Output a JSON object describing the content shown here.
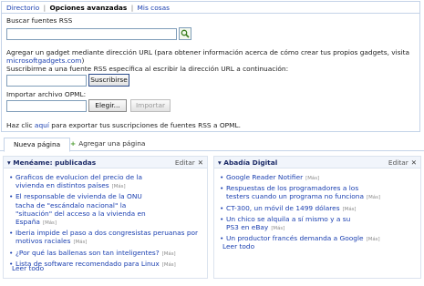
{
  "topnav": {
    "directorio": "Directorio",
    "separator": "|",
    "opciones": "Opciones avanzadas",
    "misCosas": "Mis cosas"
  },
  "panel": {
    "buscar_label": "Buscar fuentes RSS",
    "buscar_value": "",
    "url_text": "Agregar un gadget mediante dirección URL (para obtener información acerca de cómo crear tus propios gadgets, visita",
    "url_link": "microsoftgadgets.com",
    "url_after": ")",
    "subscribe_text": "Suscribirme a una fuente RSS específica al escribir la dirección URL a continuación:",
    "subscribe_value": "",
    "subscribe_button": "Suscribirse",
    "import_label": "Importar archivo OPML:",
    "import_value": "",
    "browse_button": "Elegir...",
    "import_button": "Importar",
    "export_pre": "Haz clic",
    "export_link": "aquí",
    "export_post": "para exportar tus suscripciones de fuentes RSS a OPML."
  },
  "tabs": {
    "active": "Nueva página",
    "add": "Agregar una página"
  },
  "gadgets": [
    {
      "title": "Menéame: publicadas",
      "edit": "Editar",
      "items": [
        {
          "lines": [
            "Graficos de evolucion del precio de la",
            "vivienda en distintos países"
          ],
          "more": "[Más]"
        },
        {
          "lines": [
            "El responsable de vivienda de la ONU",
            "tacha de \"escándalo nacional\" la",
            "\"situación\" del acceso a la vivienda en",
            "España"
          ],
          "more": "[Más]"
        },
        {
          "lines": [
            "Iberia impide el paso a dos congresistas peruanas por",
            "motivos raciales"
          ],
          "more": "[Más]"
        },
        {
          "lines": [
            "¿Por qué las ballenas son tan inteligentes?"
          ],
          "more": "[Más]"
        },
        {
          "lines": [
            "Lista de software recomendado para Linux"
          ],
          "more": "[Más]"
        }
      ],
      "readall": "Leer todo"
    },
    {
      "title": "Abadía Digital",
      "edit": "Editar",
      "items": [
        {
          "lines": [
            "Google Reader Notifier"
          ],
          "more": "[Más]"
        },
        {
          "lines": [
            "Respuestas de los programadores a los",
            "testers cuando un programa no funciona"
          ],
          "more": "[Más]"
        },
        {
          "lines": [
            "CT-300, un móvil de 1499 dólares"
          ],
          "more": "[Más]"
        },
        {
          "lines": [
            "Un chico se alquila a sí mismo y a su",
            "PS3 en eBay"
          ],
          "more": "[Más]"
        },
        {
          "lines": [
            "Un productor francés demanda a Google"
          ],
          "more": "[Más]"
        }
      ],
      "readall": "Leer todo"
    }
  ],
  "colors": {
    "link": "#1a3fb0",
    "border": "#c4d3e8",
    "gadgetTitle": "#1b2a66",
    "plus": "#4a9a2c"
  }
}
